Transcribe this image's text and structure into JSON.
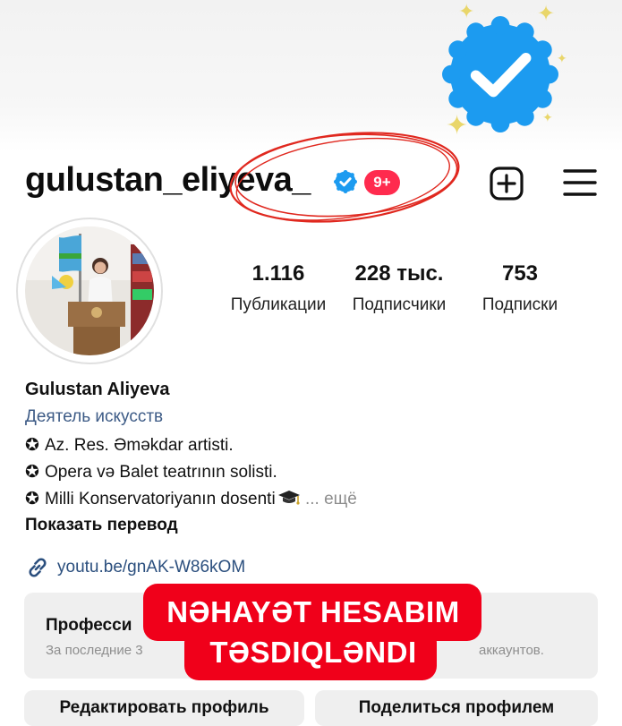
{
  "header": {
    "username": "gulustan_eliyeva_",
    "notification_count": "9+"
  },
  "stats": {
    "posts": {
      "value": "1.116",
      "label": "Публикации"
    },
    "followers": {
      "value": "228 тыс.",
      "label": "Подписчики"
    },
    "following": {
      "value": "753",
      "label": "Подписки"
    }
  },
  "bio": {
    "name": "Gulustan Aliyeva",
    "category": "Деятель искусств",
    "bullet": "✪",
    "lines": [
      "Az. Res. Əməkdar artisti.",
      "Opera və Balet teatrının solisti.",
      "Milli Konservatoriyanın dosenti"
    ],
    "more": "... ещё",
    "translate": "Показать перевод"
  },
  "link": {
    "text": "youtu.be/gnAK-W86kOM"
  },
  "professional": {
    "title": "Професси",
    "subtitle": "За последние 3",
    "subtitle_end": "аккаунтов."
  },
  "buttons": {
    "edit": "Редактировать профиль",
    "share": "Поделиться профилем"
  },
  "overlay": {
    "line1": "NƏHAYƏT HESABIM",
    "line2": "TƏSDIQLƏNDI"
  },
  "colors": {
    "verified_blue": "#1c9bf0",
    "notification_red": "#ff2b4e",
    "overlay_red": "#f0001a",
    "category_blue": "#3d5b86"
  },
  "icons": [
    "verified-badge-icon",
    "sparkle-icon",
    "plus-square-icon",
    "menu-icon",
    "link-icon",
    "graduation-cap-icon"
  ]
}
